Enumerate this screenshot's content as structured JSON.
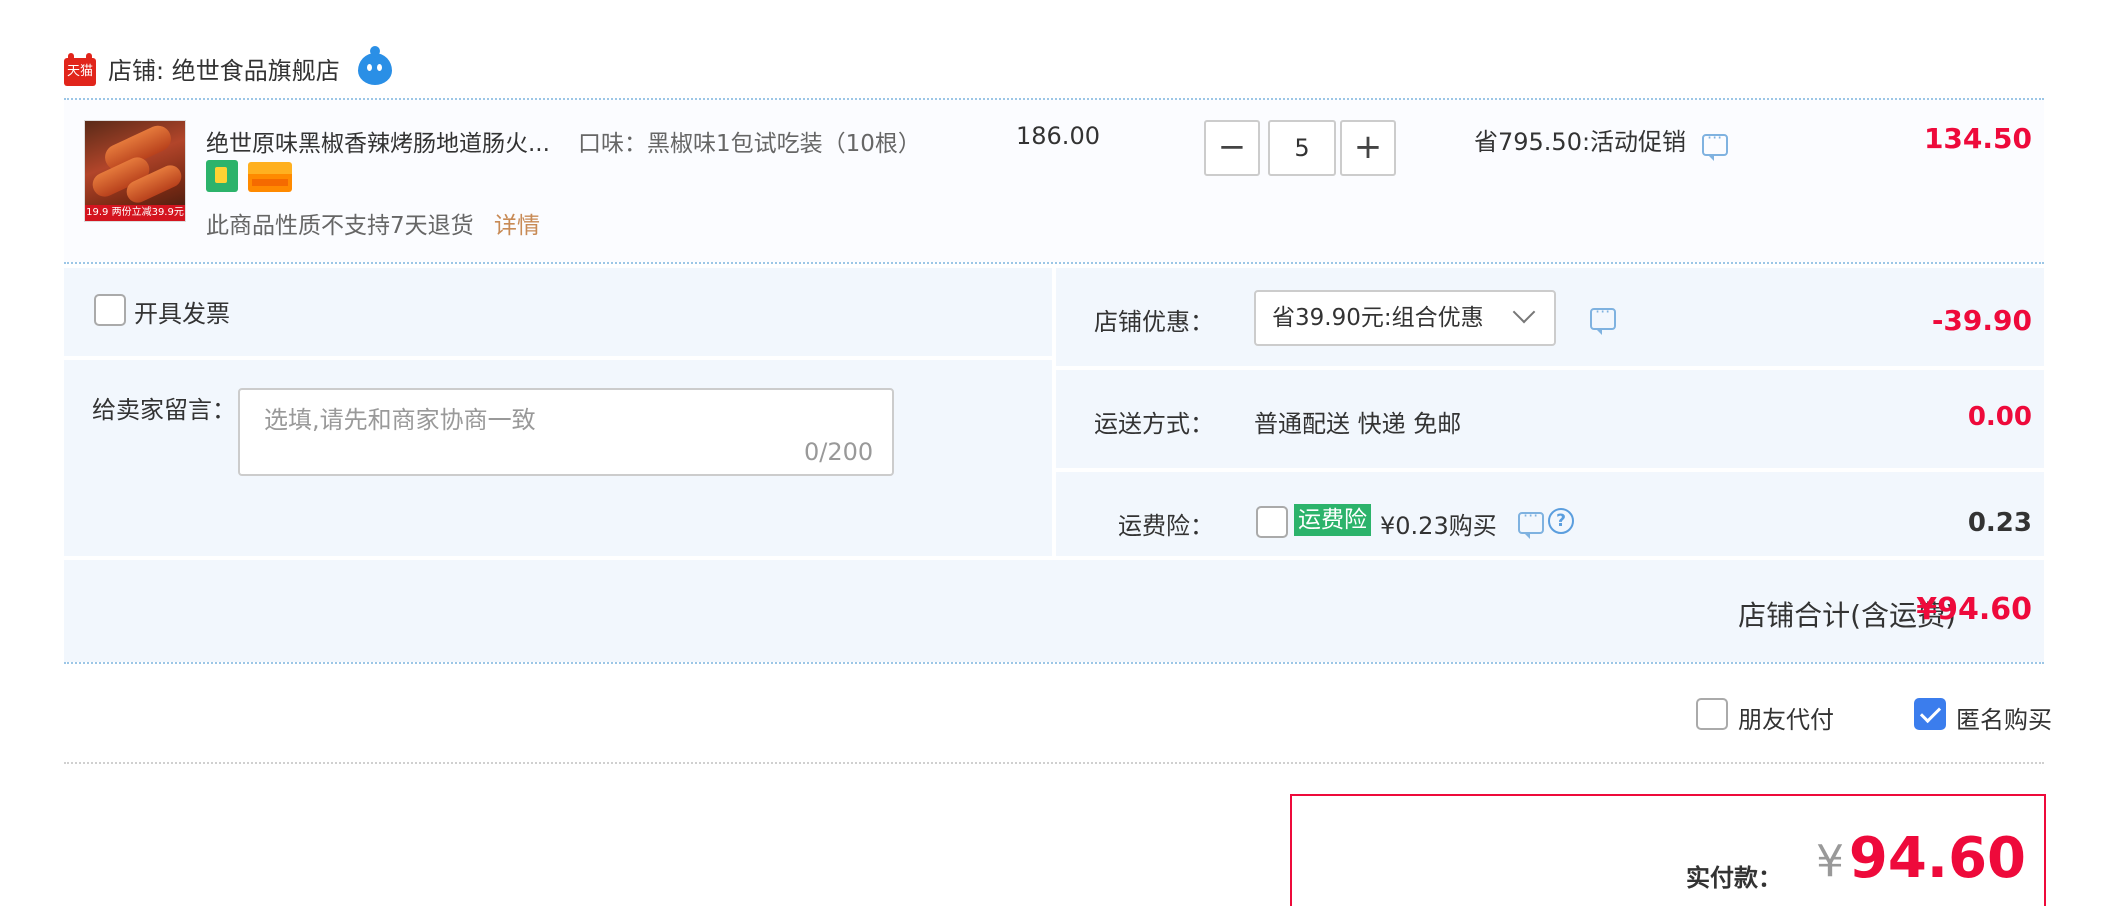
{
  "colors": {
    "accent_red": "#ee0a3b",
    "panel_bg": "#f2f7fd",
    "link_blue": "#3b7ded",
    "insurance_green": "#2cb36b"
  },
  "shop": {
    "logo_text": "天猫",
    "name": "店铺: 绝世食品旗舰店",
    "chat_icon": "wangwang-icon"
  },
  "item": {
    "image_band": "19.9 两份立减39.9元",
    "title": "绝世原味黑椒香辣烤肠地道肠火...",
    "flavor": "口味：黑椒味1包试吃装（10根）",
    "return_note": "此商品性质不支持7天退货",
    "return_link": "详情",
    "unit_price": "186.00",
    "quantity": "5",
    "qty_minus": "−",
    "qty_plus": "+",
    "promo": "省795.50:活动促销",
    "total": "134.50"
  },
  "invoice": {
    "label": "开具发票"
  },
  "message": {
    "label": "给卖家留言：",
    "placeholder": "选填,请先和商家协商一致",
    "count": "0/200"
  },
  "shop_discount": {
    "label": "店铺优惠：",
    "selected": "省39.90元:组合优惠",
    "value": "-39.90"
  },
  "shipping": {
    "label": "运送方式：",
    "text": "普通配送 快递 免邮",
    "value": "0.00"
  },
  "insurance": {
    "label": "运费险：",
    "badge": "运费险",
    "price": "¥0.23购买",
    "help": "?",
    "value": "0.23"
  },
  "subtotal": {
    "label": "店铺合计(含运费)",
    "value": "¥94.60"
  },
  "options": {
    "friend_pay": {
      "label": "朋友代付",
      "checked": false
    },
    "anonymous": {
      "label": "匿名购买",
      "checked": true
    }
  },
  "payment": {
    "label": "实付款：",
    "currency": "¥",
    "amount": "94.60"
  }
}
